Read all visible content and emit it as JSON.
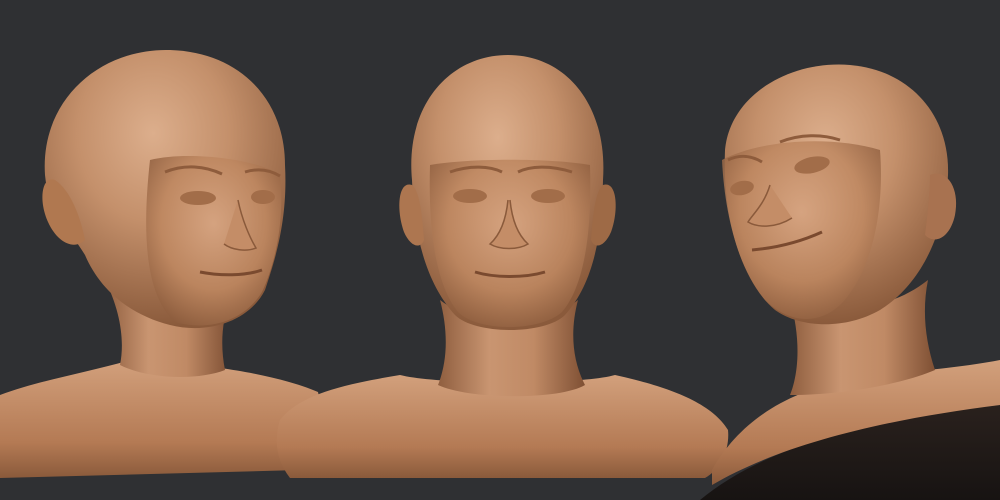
{
  "scene": {
    "subject": "sculpted-bust-render",
    "views": [
      {
        "id": "three-quarter-right",
        "facing": "right"
      },
      {
        "id": "front",
        "facing": "viewer"
      },
      {
        "id": "three-quarter-left-tilted",
        "facing": "left"
      }
    ],
    "colors": {
      "background": "#2f3033",
      "clay_light": "#cf9a75",
      "clay_mid": "#b77d57",
      "clay_dark": "#7d4f33",
      "base_shadow": "#1f1b19"
    }
  }
}
